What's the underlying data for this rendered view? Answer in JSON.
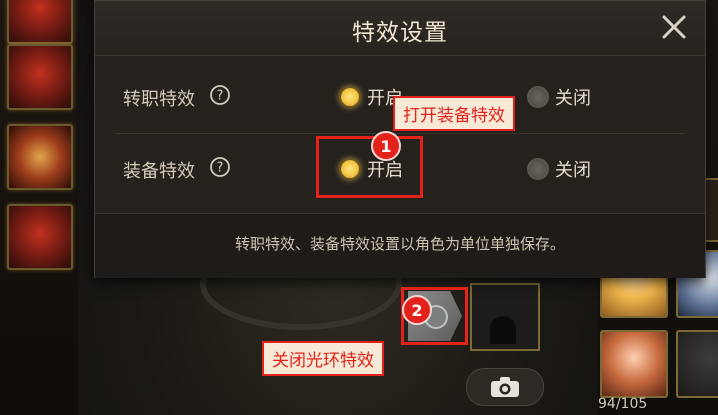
{
  "dialog": {
    "title": "特效设置",
    "rows": [
      {
        "label": "转职特效",
        "options": [
          {
            "label": "开启",
            "selected": true
          },
          {
            "label": "关闭",
            "selected": false
          }
        ]
      },
      {
        "label": "装备特效",
        "options": [
          {
            "label": "开启",
            "selected": true
          },
          {
            "label": "关闭",
            "selected": false
          }
        ]
      }
    ],
    "footer_note": "转职特效、装备特效设置以角色为单位单独保存。"
  },
  "annotations": {
    "callout_1": {
      "number": "1",
      "text": "打开装备特效"
    },
    "callout_2": {
      "number": "2",
      "text": "关闭光环特效"
    }
  },
  "inventory": {
    "counter": "94/105"
  },
  "icons": {
    "close": "close-icon",
    "help": "help-icon",
    "camera": "camera-icon"
  },
  "colors": {
    "accent_yellow": "#f6c744",
    "annotation_red": "#e3231b"
  }
}
